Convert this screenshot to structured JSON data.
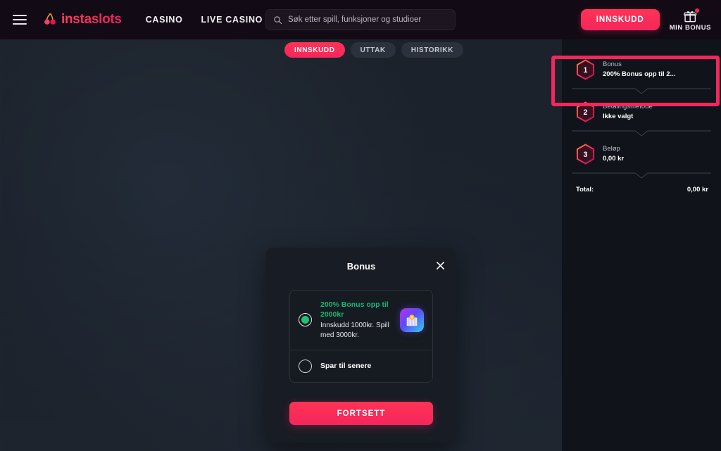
{
  "header": {
    "menu_icon": "hamburger-icon",
    "logo_text": "instaslots",
    "nav": [
      {
        "label": "CASINO"
      },
      {
        "label": "LIVE CASINO"
      }
    ],
    "search": {
      "icon": "search-icon",
      "placeholder": "Søk etter spill, funksjoner og studioer",
      "value": ""
    },
    "deposit_button": "INNSKUDD",
    "bonus_button": {
      "icon": "gift-icon",
      "label": "MIN BONUS",
      "has_notification": true
    }
  },
  "tabs": [
    {
      "label": "INNSKUDD",
      "active": true
    },
    {
      "label": "UTTAK",
      "active": false
    },
    {
      "label": "HISTORIKK",
      "active": false
    }
  ],
  "sidebar": {
    "steps": [
      {
        "number": "1",
        "label": "Bonus",
        "value": "200% Bonus opp til 2..."
      },
      {
        "number": "2",
        "label": "Betalingsmetode",
        "value": "Ikke valgt"
      },
      {
        "number": "3",
        "label": "Beløp",
        "value": "0,00 kr"
      }
    ],
    "total_label": "Total:",
    "total_value": "0,00 kr"
  },
  "modal": {
    "title": "Bonus",
    "close_icon": "close-icon",
    "options": [
      {
        "selected": true,
        "title": "200% Bonus opp til 2000kr",
        "subtitle": "Innskudd 1000kr. Spill med 3000kr.",
        "thumb_icon": "bonus-gift-icon"
      },
      {
        "selected": false,
        "title": "Spar til senere"
      }
    ],
    "continue_button": "FORTSETT"
  },
  "colors": {
    "accent_red": "#f5265c",
    "bonus_green": "#19b874",
    "header_bg": "#120a14",
    "sidebar_bg": "#10141a",
    "modal_bg": "#181c24",
    "highlight_border": "#f5265c"
  }
}
